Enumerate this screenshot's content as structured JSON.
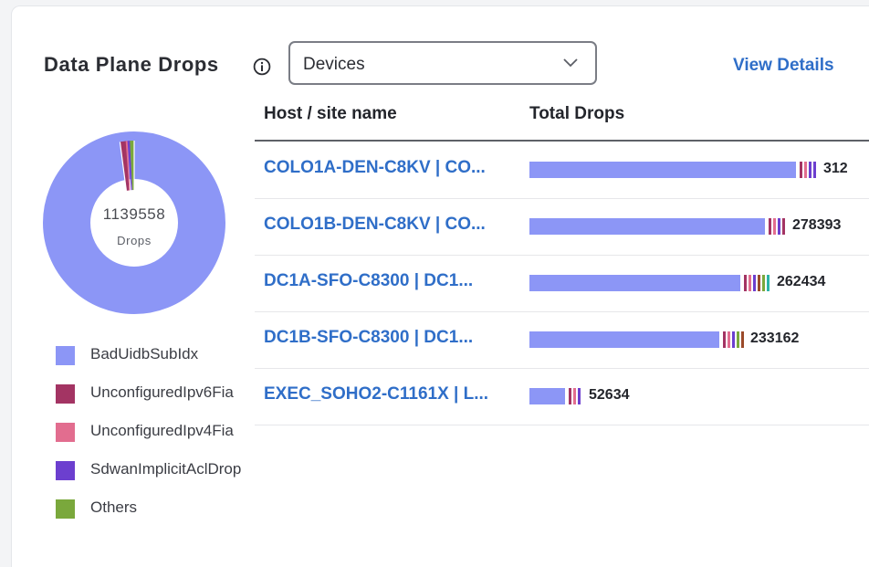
{
  "panel": {
    "title": "Data Plane Drops",
    "view_details": "View Details"
  },
  "selector": {
    "value": "Devices"
  },
  "table": {
    "headers": {
      "host": "Host / site name",
      "total": "Total Drops"
    },
    "rows": [
      {
        "host": "COLO1A-DEN-C8KV | CO...",
        "total_label": "312",
        "total": 312000
      },
      {
        "host": "COLO1B-DEN-C8KV | CO...",
        "total_label": "278393",
        "total": 278393
      },
      {
        "host": "DC1A-SFO-C8300 | DC1...",
        "total_label": "262434",
        "total": 262434
      },
      {
        "host": "DC1B-SFO-C8300 | DC1...",
        "total_label": "233162",
        "total": 233162
      },
      {
        "host": "EXEC_SOHO2-C1161X | L...",
        "total_label": "52634",
        "total": 52634
      }
    ]
  },
  "donut": {
    "total": "1139558",
    "unit": "Drops"
  },
  "legend": [
    {
      "label": "BadUidbSubIdx",
      "color": "#8c96f6"
    },
    {
      "label": "UnconfiguredIpv6Fia",
      "color": "#a33463"
    },
    {
      "label": "UnconfiguredIpv4Fia",
      "color": "#e26d8f"
    },
    {
      "label": "SdwanImplicitAclDrop",
      "color": "#6c3fcf"
    },
    {
      "label": "Others",
      "color": "#7aa83c"
    }
  ],
  "colors": {
    "accent": "#2f6ec8",
    "other_segments": [
      "#a33463",
      "#e26d8f",
      "#6c3fcf",
      "#7aa83c",
      "#9b4a2a",
      "#2bb3a6"
    ]
  }
}
